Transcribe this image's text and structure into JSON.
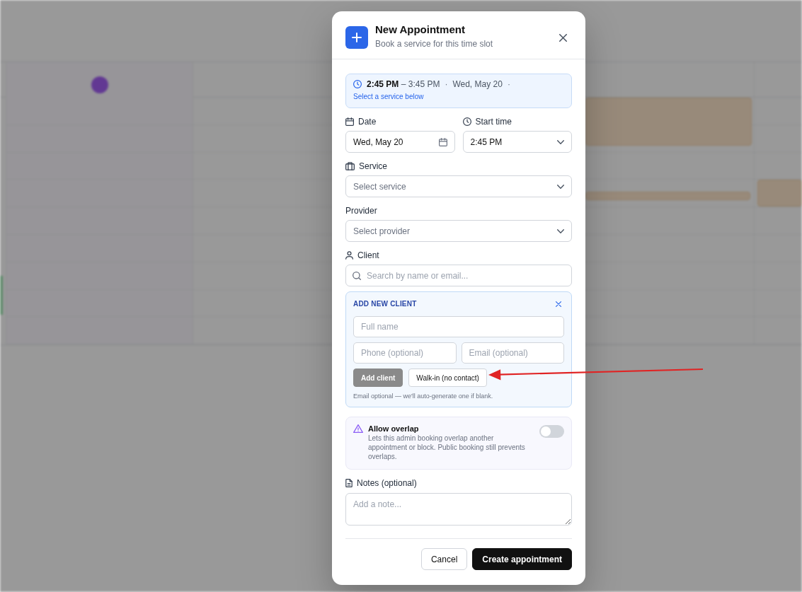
{
  "calendar": {
    "days": [
      {
        "today": true
      },
      {
        "today": false
      },
      {
        "today": false
      },
      {
        "today": false
      }
    ]
  },
  "dialog": {
    "title": "New Appointment",
    "subtitle": "Book a service for this time slot"
  },
  "summary": {
    "segments": [
      {
        "kind": "time",
        "text": "**2:45 PM** – 3:45 PM"
      },
      {
        "kind": "dot",
        "text": "·"
      },
      {
        "kind": "date",
        "text": "Wed, May 20"
      },
      {
        "kind": "dot",
        "text": "·"
      }
    ],
    "hint": "Select a service below"
  },
  "schedule": [
    {
      "kind": "date",
      "label": "Date",
      "value": "Wed, May 20"
    },
    {
      "kind": "time",
      "label": "Start time",
      "value": "2:45 PM"
    }
  ],
  "service": {
    "label": "Service",
    "placeholder": "Select service"
  },
  "provider": {
    "label": "Provider",
    "placeholder": "Select provider"
  },
  "client": {
    "label": "Client",
    "placeholder": "Search by name or email...",
    "new_client": {
      "title": "ADD NEW CLIENT",
      "fields": [
        {
          "placeholder": "Full name"
        },
        {
          "placeholder": "Phone (optional)"
        },
        {
          "placeholder": "Email (optional)"
        }
      ],
      "buttons": [
        {
          "kind": "primary",
          "label": "Add client",
          "disabled": true
        },
        {
          "kind": "secondary",
          "label": "Walk-in (no contact)",
          "disabled": false
        }
      ],
      "note": "Email optional — we'll auto-generate one if blank."
    }
  },
  "overlap": {
    "title": "Allow overlap",
    "description": "Lets this admin booking overlap another appointment or block. Public booking still prevents overlaps.",
    "on": false
  },
  "notes": {
    "label": "Notes (optional)",
    "placeholder": "Add a note..."
  },
  "actions": [
    {
      "kind": "secondary",
      "label": "Cancel"
    },
    {
      "kind": "primary",
      "label": "Create appointment"
    }
  ]
}
